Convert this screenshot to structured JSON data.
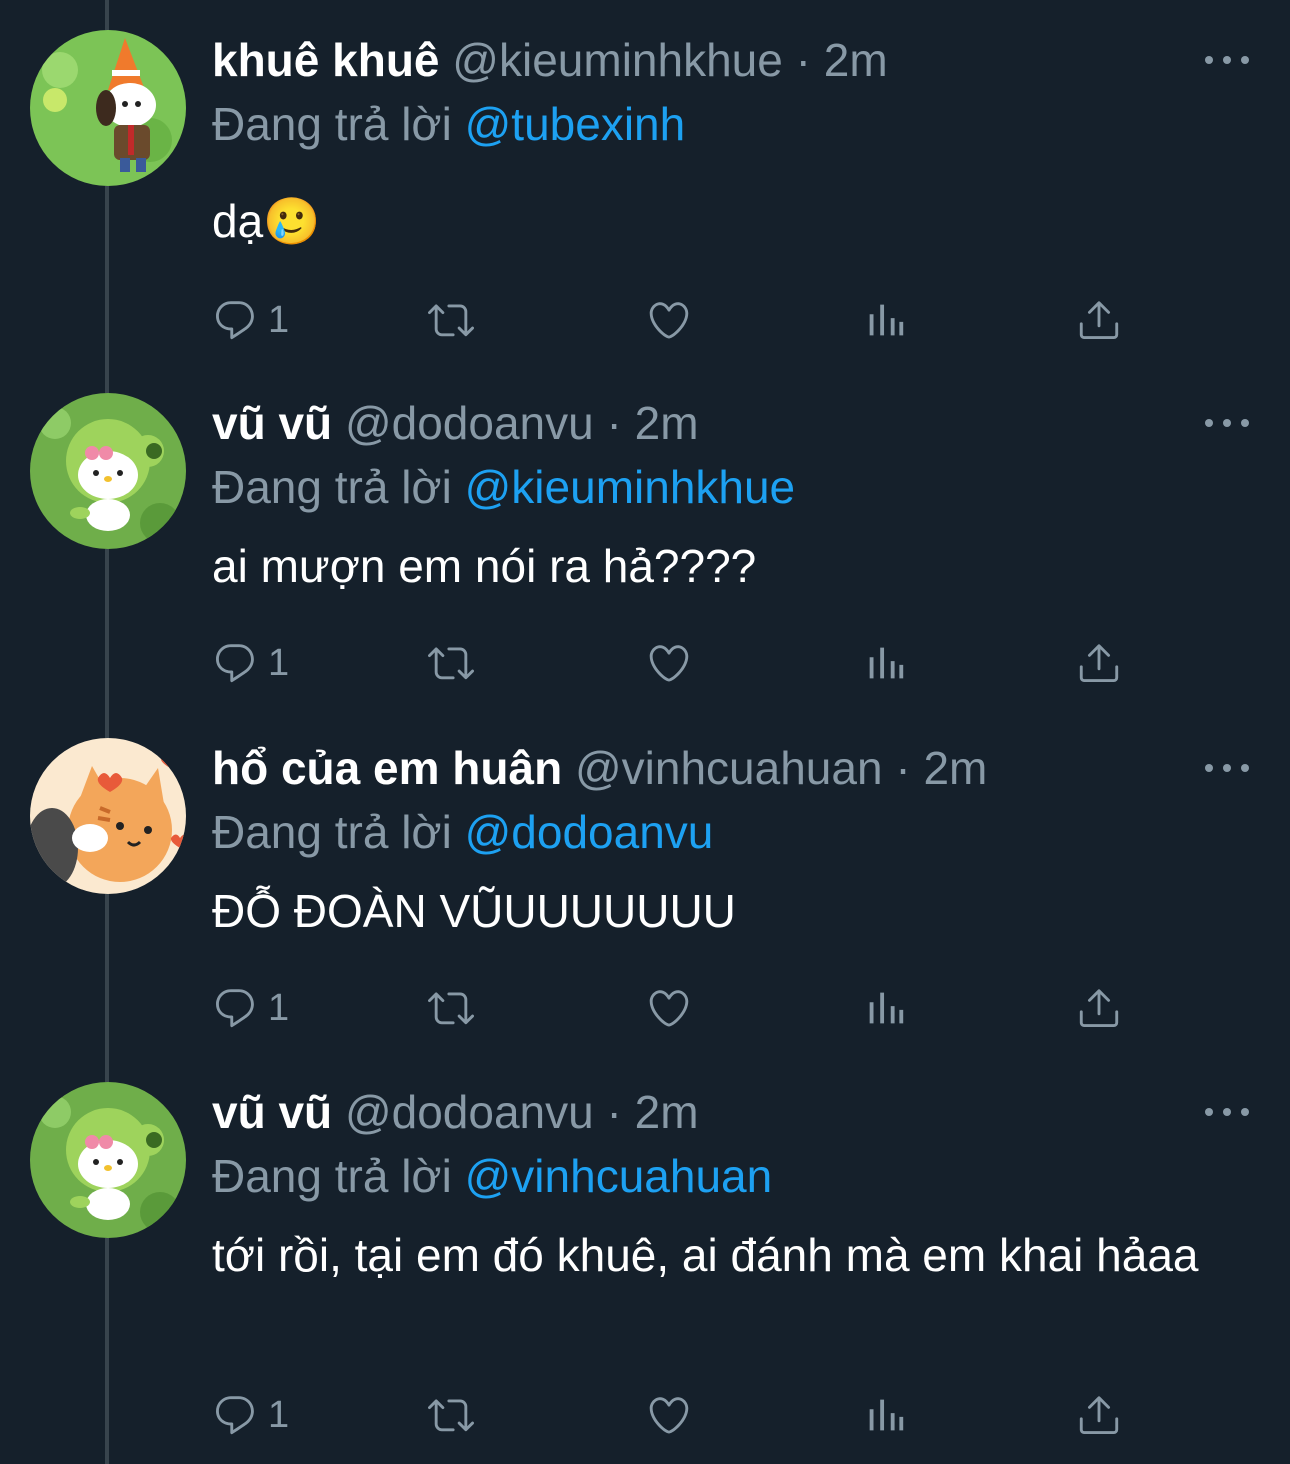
{
  "tweets": [
    {
      "name": "khuê khuê",
      "handle": "@kieuminhkhue",
      "time": "2m",
      "reply_prefix": "Đang trả lời",
      "reply_to": "@tubexinh",
      "text": "dạ🥲",
      "replies": "1",
      "avatar": "pochacco-cone-avatar"
    },
    {
      "name": "vũ vũ",
      "handle": "@dodoanvu",
      "time": "2m",
      "reply_prefix": "Đang trả lời",
      "reply_to": "@kieuminhkhue",
      "text": "ai mượn em nói ra hả????",
      "replies": "1",
      "avatar": "hello-kitty-peashooter-avatar"
    },
    {
      "name": "hổ của em huân",
      "handle": "@vinhcuahuan",
      "time": "2m",
      "reply_prefix": "Đang trả lời",
      "reply_to": "@dodoanvu",
      "text": "ĐỖ ĐOÀN VŨUUUUUUU",
      "replies": "1",
      "avatar": "orange-cat-hearts-avatar"
    },
    {
      "name": "vũ vũ",
      "handle": "@dodoanvu",
      "time": "2m",
      "reply_prefix": "Đang trả lời",
      "reply_to": "@vinhcuahuan",
      "text": "tới rồi, tại em đó khuê, ai đánh mà em khai hảaa",
      "replies": "1",
      "avatar": "hello-kitty-peashooter-avatar"
    }
  ],
  "separator": "·",
  "icons": {
    "reply": "reply-icon",
    "retweet": "retweet-icon",
    "like": "like-icon",
    "analytics": "analytics-icon",
    "share": "share-icon",
    "more": "more-icon"
  },
  "colors": {
    "background": "#15202b",
    "secondary_text": "#8899a6",
    "mention": "#1da1f2",
    "thread_line": "#38444d"
  }
}
